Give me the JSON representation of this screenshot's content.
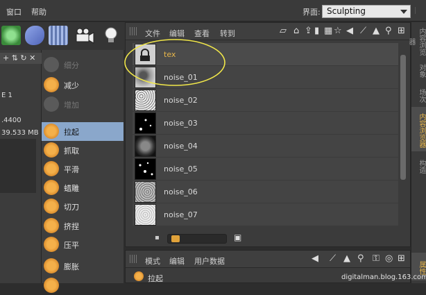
{
  "menubar": {
    "items": [
      "窗口",
      "帮助"
    ],
    "layout_label": "界面:",
    "layout_value": "Sculpting"
  },
  "toolbar_icons": [
    "sculpt-brush-icon",
    "tube-tool-icon",
    "plane-grid-icon",
    "camera-icon",
    "light-bulb-icon"
  ],
  "left_strip": {
    "header_glyphs": "+ ⇅ ↻ ✕",
    "values": [
      "E 1",
      ".4400",
      "39.533 MB"
    ]
  },
  "brush_list": {
    "items": [
      {
        "label": "细分",
        "dim": true,
        "icon": "subdivide-icon"
      },
      {
        "label": "减少",
        "dim": false,
        "icon": "decrease-icon"
      },
      {
        "label": "增加",
        "dim": true,
        "icon": "increase-icon"
      },
      {
        "label": "拉起",
        "dim": false,
        "icon": "pull-brush-icon",
        "selected": true
      },
      {
        "label": "抓取",
        "dim": false,
        "icon": "grab-brush-icon"
      },
      {
        "label": "平滑",
        "dim": false,
        "icon": "smooth-brush-icon"
      },
      {
        "label": "蜡雕",
        "dim": false,
        "icon": "wax-brush-icon"
      },
      {
        "label": "切刀",
        "dim": false,
        "icon": "knife-brush-icon"
      },
      {
        "label": "挤捏",
        "dim": false,
        "icon": "pinch-brush-icon"
      },
      {
        "label": "压平",
        "dim": false,
        "icon": "flatten-brush-icon"
      },
      {
        "label": "膨胀",
        "dim": false,
        "icon": "inflate-brush-icon"
      },
      {
        "label": "",
        "dim": false,
        "icon": "brush-icon"
      }
    ]
  },
  "content_manager": {
    "toolbar": [
      "文件",
      "编辑",
      "查看",
      "转到"
    ],
    "rows": [
      {
        "label": "tex",
        "selected": true,
        "thumb": "folder"
      },
      {
        "label": "noise_01",
        "thumb": "noise"
      },
      {
        "label": "noise_02",
        "thumb": "noise-light"
      },
      {
        "label": "noise_03",
        "thumb": "dots"
      },
      {
        "label": "noise_04",
        "thumb": "noise-dark"
      },
      {
        "label": "noise_05",
        "thumb": "dots"
      },
      {
        "label": "noise_06",
        "thumb": "noise-light"
      },
      {
        "label": "noise_07",
        "thumb": "speckle"
      }
    ],
    "zoom_slider": 0.08
  },
  "attributes": {
    "toolbar": [
      "模式",
      "编辑",
      "用户数据"
    ],
    "item_label": "拉起"
  },
  "right_tabs": [
    {
      "label": "内容浏览器"
    },
    {
      "label": "对象"
    },
    {
      "label": "场次"
    },
    {
      "label": "内容浏览器",
      "selected": true
    },
    {
      "label": "构造"
    },
    {
      "label": "属性",
      "selected": true
    }
  ],
  "watermark": "digitalman.blog.163.com",
  "colors": {
    "accent": "#e8b64a",
    "selection": "#8aa7cb",
    "annotation": "#f2e84a"
  }
}
